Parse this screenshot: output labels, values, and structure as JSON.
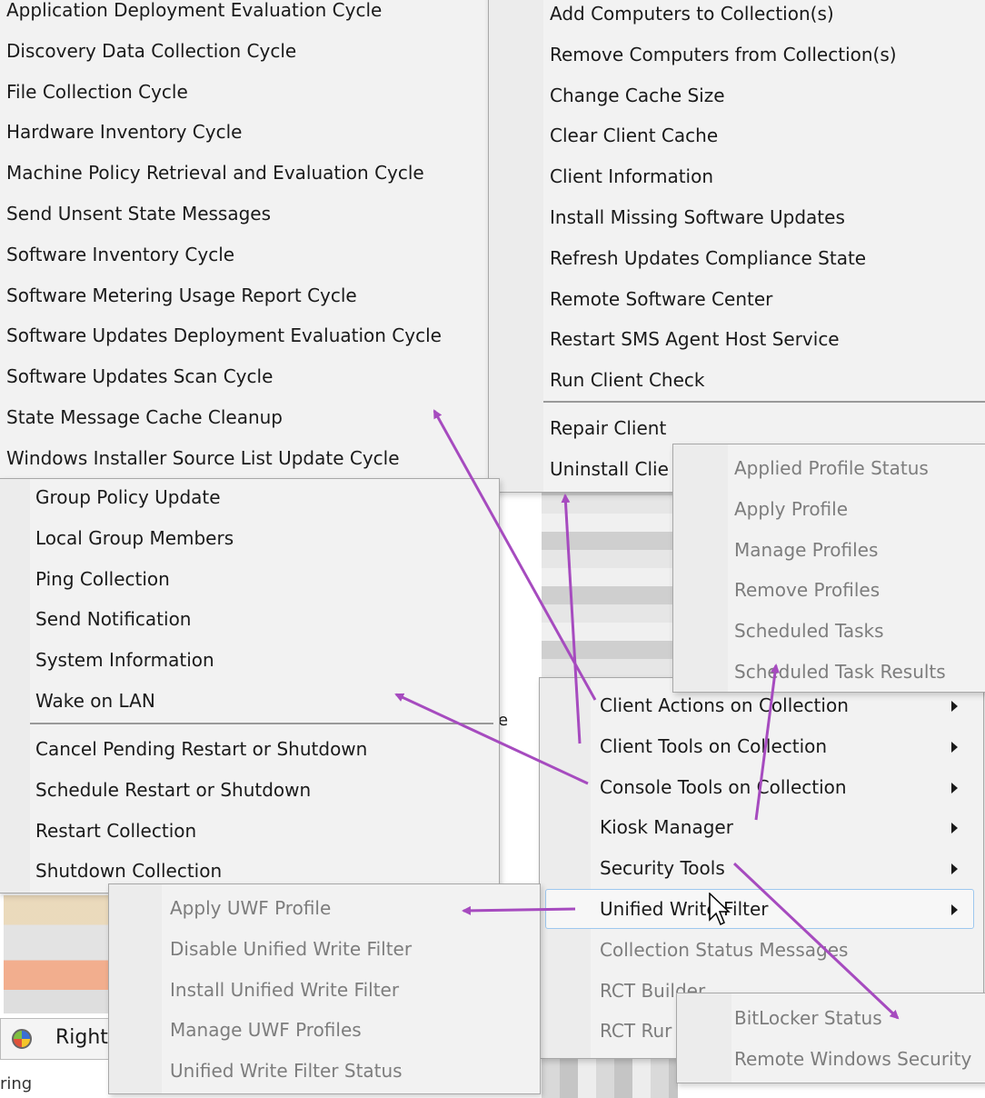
{
  "client_notification_menu": {
    "items": [
      "Application Deployment Evaluation Cycle",
      "Discovery Data Collection Cycle",
      "File Collection Cycle",
      "Hardware Inventory Cycle",
      "Machine Policy Retrieval and Evaluation Cycle",
      "Send Unsent State Messages",
      "Software Inventory Cycle",
      "Software Metering Usage Report Cycle",
      "Software Updates Deployment Evaluation Cycle",
      "Software Updates Scan Cycle",
      "State Message Cache Cleanup",
      "Windows Installer Source List Update Cycle"
    ]
  },
  "client_tools_menu": {
    "items": [
      "Add Computers to Collection(s)",
      "Remove Computers from Collection(s)",
      "Change Cache Size",
      "Clear Client Cache",
      "Client Information",
      "Install Missing Software Updates",
      "Refresh Updates Compliance State",
      "Remote Software Center",
      "Restart SMS Agent Host Service",
      "Run Client Check"
    ],
    "items2": [
      "Repair Client",
      "Uninstall Clie"
    ]
  },
  "console_tools_menu": {
    "items": [
      "Group Policy Update",
      "Local Group Members",
      "Ping Collection",
      "Send Notification",
      "System Information",
      "Wake on LAN"
    ],
    "items2": [
      "Cancel Pending Restart or Shutdown",
      "Schedule Restart or Shutdown",
      "Restart Collection",
      "Shutdown Collection"
    ]
  },
  "kiosk_menu": {
    "items": [
      "Applied Profile Status",
      "Apply Profile",
      "Manage Profiles",
      "Remove Profiles",
      "Scheduled Tasks",
      "Scheduled Task Results"
    ]
  },
  "main_menu": {
    "items": [
      "Client Actions on Collection",
      "Client Tools on Collection",
      "Console Tools on Collection",
      "Kiosk Manager",
      "Security Tools",
      "Unified Write Filter",
      "Collection Status Messages",
      "RCT Builder",
      "RCT Rur"
    ],
    "highlighted_index": 5
  },
  "uwf_menu": {
    "items": [
      "Apply UWF Profile",
      "Disable Unified Write Filter",
      "Install Unified Write Filter",
      "Manage UWF Profiles",
      "Unified Write Filter Status"
    ]
  },
  "security_menu": {
    "items": [
      "BitLocker Status",
      "Remote Windows Security"
    ]
  },
  "background": {
    "right_click_label": "Right",
    "partial_text_bottom": "ring",
    "partial_char_e": "e"
  },
  "colors": {
    "menu_bg": "#f2f2f2",
    "arrow": "#a64bbf",
    "highlight_border": "#9ec8ef",
    "disabled_text": "#7d7d7d"
  }
}
